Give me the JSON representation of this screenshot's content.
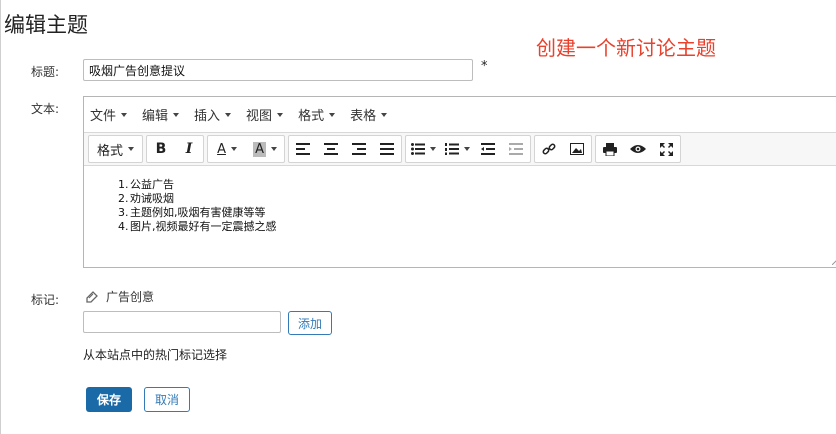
{
  "page": {
    "title": "编辑主题",
    "annotation": "创建一个新讨论主题"
  },
  "form": {
    "title_label": "标题:",
    "title_value": "吸烟广告创意提议",
    "required_mark": "*",
    "body_label": "文本:",
    "tags_label": "标记:",
    "hint": "从本站点中的热门标记选择",
    "add_label": "添加",
    "save_label": "保存",
    "cancel_label": "取消"
  },
  "editor": {
    "menus": [
      "文件",
      "编辑",
      "插入",
      "视图",
      "格式",
      "表格"
    ],
    "toolbar": {
      "format_label": "格式",
      "bold": "B",
      "italic": "I",
      "font_color": "A",
      "bg_color": "A",
      "icons": [
        "align-left-icon",
        "align-center-icon",
        "align-right-icon",
        "align-justify-icon",
        "bullet-list-icon",
        "numbered-list-icon",
        "outdent-icon",
        "indent-icon",
        "link-icon",
        "image-icon",
        "print-icon",
        "preview-icon",
        "fullscreen-icon"
      ]
    },
    "content": [
      {
        "num": "1.",
        "text": "公益广告"
      },
      {
        "num": "2.",
        "text": "劝诫吸烟"
      },
      {
        "num": "3.",
        "text": "主题例如,吸烟有害健康等等"
      },
      {
        "num": "4.",
        "text": "图片,视频最好有一定震撼之感"
      }
    ]
  },
  "tags": {
    "items": [
      "广告创意"
    ]
  },
  "colors": {
    "annotation": "#e8412c",
    "primary": "#1a6aa8",
    "link": "#337ab7"
  }
}
